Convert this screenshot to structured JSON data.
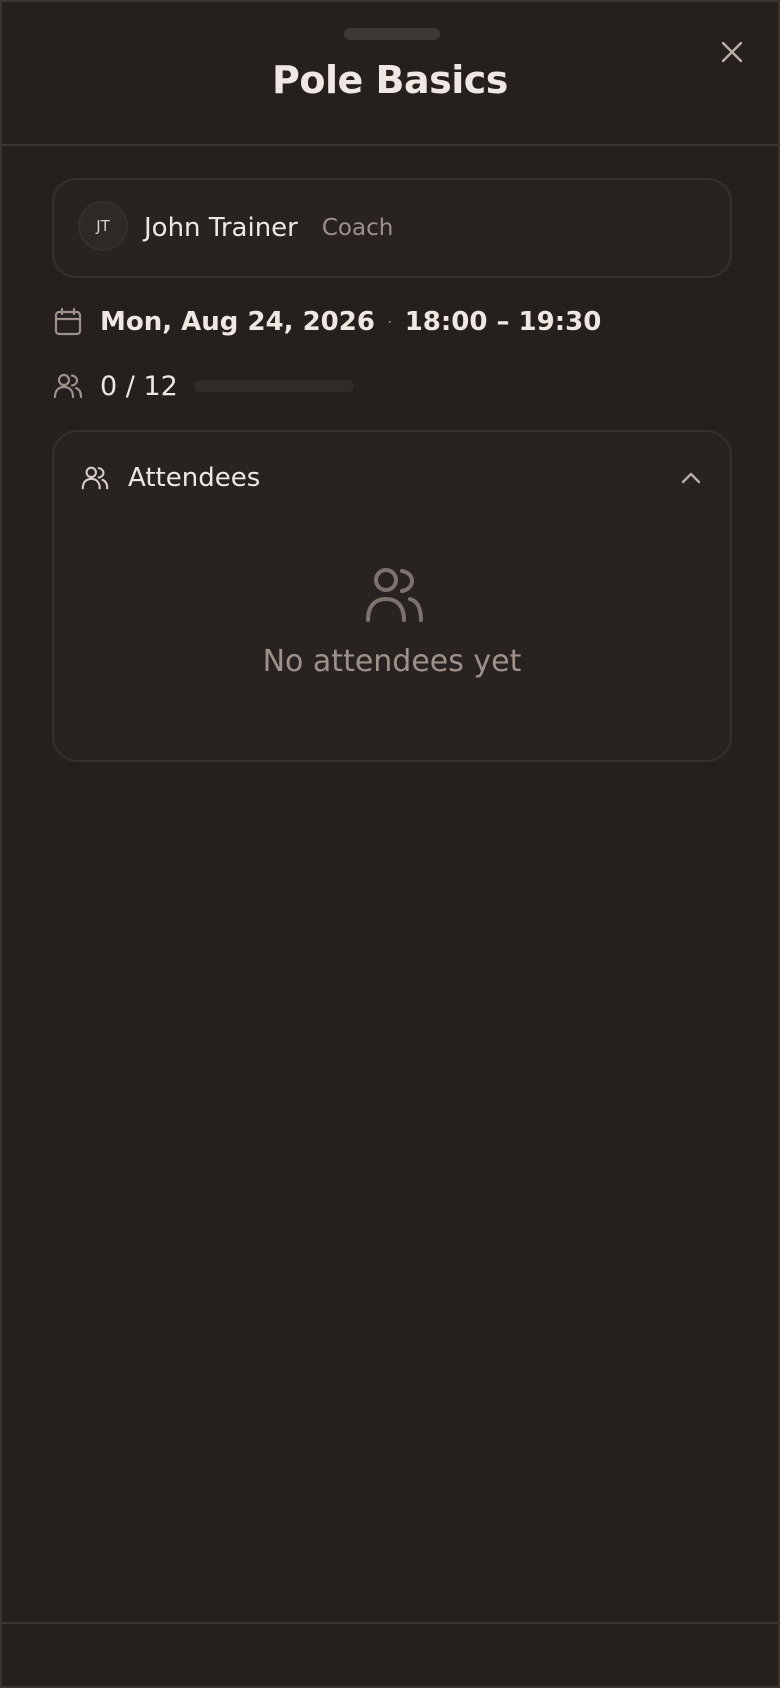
{
  "sheet": {
    "title": "Pole Basics",
    "close_icon": "close-icon"
  },
  "coach": {
    "initials": "JT",
    "name": "John Trainer",
    "role": "Coach"
  },
  "session": {
    "date": "Mon, Aug 24, 2026",
    "separator": "·",
    "time": "18:00 – 19:30",
    "capacity_text": "0 / 12",
    "booked": 0,
    "capacity": 12
  },
  "attendees": {
    "title": "Attendees",
    "expanded": true,
    "empty_text": "No attendees yet"
  },
  "colors": {
    "background": "#25201e",
    "text": "#efe8e2",
    "muted": "#9d918a",
    "border": "#34302d"
  }
}
